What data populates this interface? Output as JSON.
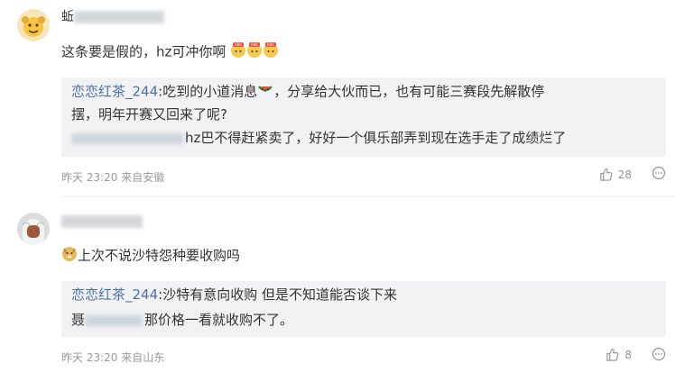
{
  "comments": [
    {
      "user_first_char": "蚯",
      "text": "这条要是假的，hz可冲你啊",
      "reply": {
        "user": "恋恋红茶_244",
        "line1_text": ":吃到的小道消息",
        "line1_rest": "，分享给大伙而已，也有可能三赛段先解散停",
        "line2": "摆，明年开赛又回来了呢?",
        "line3": "hz巴不得赶紧卖了，好好一个俱乐部弄到现在选手走了成绩烂了"
      },
      "meta": "昨天 23:20 来自安徽",
      "likes": "28"
    },
    {
      "user_first_char": "",
      "text": "上次不说沙特怨种要收购吗",
      "reply": {
        "user": "恋恋红茶_244",
        "line1_text": ":沙特有意向收购 但是不知道能否谈下来",
        "line2_prefix": "聂",
        "line2": "那价格一看就收购不了。"
      },
      "meta": "昨天 23:20 来自山东",
      "likes": "8"
    }
  ],
  "icons": {
    "like": "thumbs-up-icon",
    "more": "more-dots-icon",
    "emoji_666": "emoji-666-icon",
    "emoji_watermelon": "watermelon-icon",
    "emoji_doge": "doge-icon"
  },
  "colors": {
    "reply_user": "#4a72a8",
    "reply_bg": "#f2f2f5",
    "meta": "#999999"
  }
}
